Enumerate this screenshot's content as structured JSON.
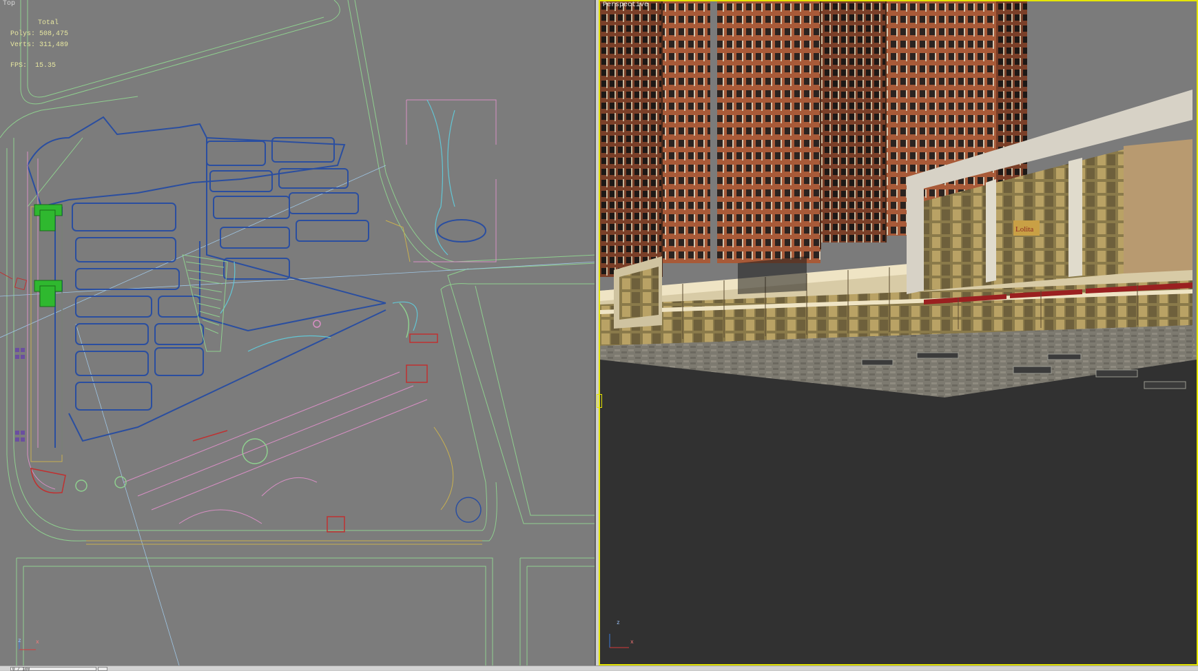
{
  "viewports": {
    "top": {
      "label": "Top",
      "stats": {
        "title": "Total",
        "polys_label": "Polys:",
        "polys_value": "508,475",
        "verts_label": "Verts:",
        "verts_value": "311,489",
        "fps_label": "FPS:",
        "fps_value": "15.35"
      },
      "axis": {
        "z": "z",
        "x": "x"
      }
    },
    "perspective": {
      "label": "Perspective",
      "axis": {
        "z": "z",
        "x": "x"
      },
      "shop_sign": "Lolita"
    }
  },
  "statusbar": {
    "coord_field": "0 / 100"
  },
  "colors": {
    "viewport_bg": "#7c7c7c",
    "persp_bg": "#313131",
    "active_border": "#e6e600",
    "plan_blue": "#2a4ea0",
    "plan_green": "#8fd08f",
    "plan_pink": "#d98fc5",
    "plan_cyan": "#62c7d6",
    "building_brick": "#b5603d"
  }
}
